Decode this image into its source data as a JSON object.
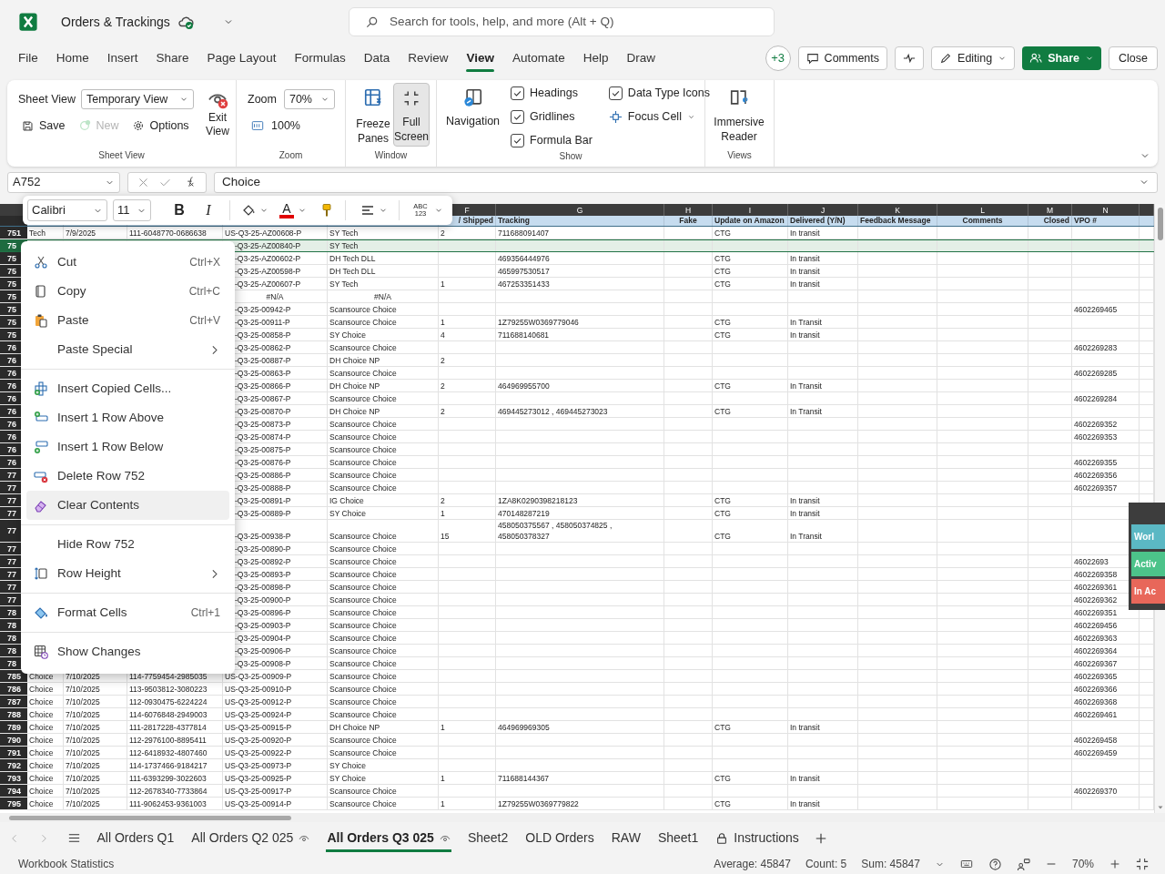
{
  "title_bar": {
    "file_name": "Orders & Trackings",
    "search": {
      "placeholder": "Search for tools, help, and more (Alt + Q)"
    }
  },
  "menu_tabs": [
    {
      "label": "File",
      "selected": false
    },
    {
      "label": "Home",
      "selected": false
    },
    {
      "label": "Insert",
      "selected": false
    },
    {
      "label": "Share",
      "selected": false
    },
    {
      "label": "Page Layout",
      "selected": false
    },
    {
      "label": "Formulas",
      "selected": false
    },
    {
      "label": "Data",
      "selected": false
    },
    {
      "label": "Review",
      "selected": false
    },
    {
      "label": "View",
      "selected": true
    },
    {
      "label": "Automate",
      "selected": false
    },
    {
      "label": "Help",
      "selected": false
    },
    {
      "label": "Draw",
      "selected": false
    }
  ],
  "header_actions": {
    "collaborators": "+3",
    "comments": "Comments",
    "editing": "Editing",
    "share": "Share",
    "close": "Close"
  },
  "ribbon": {
    "sheet_view": {
      "label": "Sheet View",
      "title": "Sheet View",
      "view": "Temporary View",
      "save": "Save",
      "new": {
        "label": "New",
        "disabled": true
      },
      "options": "Options",
      "exit": "Exit View"
    },
    "zoom": {
      "label": "Zoom",
      "title": "Zoom",
      "value": "70%",
      "reset": "100%"
    },
    "window": {
      "label": "Window",
      "freeze": "Freeze Panes",
      "full_screen": {
        "label": "Full Screen",
        "pressed": true
      }
    },
    "show": {
      "label": "Show",
      "navigation": "Navigation",
      "options": [
        {
          "kind": "checkbox",
          "label": "Headings",
          "checked": true
        },
        {
          "kind": "checkbox",
          "label": "Gridlines",
          "checked": true
        },
        {
          "kind": "checkbox",
          "label": "Formula Bar",
          "checked": true
        },
        {
          "kind": "checkbox",
          "label": "Data Type Icons",
          "checked": true
        },
        {
          "kind": "dropdown",
          "label": "Focus Cell"
        }
      ]
    },
    "views": {
      "label": "Views",
      "immersive_reader": "Immersive Reader"
    }
  },
  "formula_bar": {
    "name_box": "A752",
    "formula": "Choice"
  },
  "sheet": {
    "columns": [
      {
        "letter": "F",
        "header": "/ Shipped"
      },
      {
        "letter": "G",
        "header": "Tracking"
      },
      {
        "letter": "H",
        "header": "Fake"
      },
      {
        "letter": "I",
        "header": "Update on Amazon"
      },
      {
        "letter": "J",
        "header": "Delivered (Y/N)"
      },
      {
        "letter": "K",
        "header": "Feedback Message"
      },
      {
        "letter": "L",
        "header": "Comments"
      },
      {
        "letter": "M",
        "header": "Closed"
      },
      {
        "letter": "N",
        "header": "VPO #"
      }
    ],
    "rows": [
      {
        "number": "751",
        "kind": "visible",
        "selected": false,
        "cells": {
          "A": "Tech",
          "B": "7/9/2025",
          "C": "111-6048770-0686638",
          "D": "US-Q3-25-AZ00608-P",
          "E": "SY Tech",
          "F": "2",
          "G": "711688091407",
          "I": "CTG",
          "J": "In transit"
        }
      },
      {
        "number": "75",
        "kind": "covered",
        "selected": true,
        "cells": {
          "D": "-Q3-25-AZ00840-P",
          "E": "SY Tech"
        }
      },
      {
        "number": "75",
        "kind": "covered",
        "selected": false,
        "cells": {
          "D": "-Q3-25-AZ00602-P",
          "E": "DH Tech DLL",
          "G": "469356444976",
          "I": "CTG",
          "J": "In transit"
        }
      },
      {
        "number": "75",
        "kind": "covered",
        "selected": false,
        "cells": {
          "D": "-Q3-25-AZ00598-P",
          "E": "DH Tech DLL",
          "G": "465997530517",
          "I": "CTG",
          "J": "In transit"
        }
      },
      {
        "number": "75",
        "kind": "covered",
        "selected": false,
        "cells": {
          "D": "-Q3-25-AZ00607-P",
          "E": "SY Tech",
          "F": "1",
          "G": "467253351433",
          "I": "CTG",
          "J": "In transit"
        }
      },
      {
        "number": "75",
        "kind": "covered_centered",
        "selected": false,
        "cells": {
          "D": "#N/A",
          "E": "#N/A"
        }
      },
      {
        "number": "75",
        "kind": "covered",
        "selected": false,
        "cells": {
          "D": "-Q3-25-00942-P",
          "E": "Scansource Choice",
          "N": "4602269465"
        }
      },
      {
        "number": "75",
        "kind": "covered",
        "selected": false,
        "cells": {
          "D": "-Q3-25-00911-P",
          "E": "Scansource Choice",
          "F": "1",
          "G": "1Z79255W0369779046",
          "I": "CTG",
          "J": "In Transit"
        }
      },
      {
        "number": "75",
        "kind": "covered",
        "selected": false,
        "cells": {
          "D": "-Q3-25-00858-P",
          "E": "SY Choice",
          "F": "4",
          "G": "711688140681",
          "I": "CTG",
          "J": "In transit"
        }
      },
      {
        "number": "76",
        "kind": "covered",
        "selected": false,
        "cells": {
          "D": "-Q3-25-00862-P",
          "E": "Scansource Choice",
          "N": "4602269283"
        }
      },
      {
        "number": "76",
        "kind": "covered",
        "selected": false,
        "cells": {
          "D": "-Q3-25-00887-P",
          "E": "DH Choice NP",
          "F": "2"
        }
      },
      {
        "number": "76",
        "kind": "covered",
        "selected": false,
        "cells": {
          "D": "-Q3-25-00863-P",
          "E": "Scansource Choice",
          "N": "4602269285"
        }
      },
      {
        "number": "76",
        "kind": "covered",
        "selected": false,
        "cells": {
          "D": "-Q3-25-00866-P",
          "E": "DH Choice NP",
          "F": "2",
          "G": "464969955700",
          "I": "CTG",
          "J": "In Transit"
        }
      },
      {
        "number": "76",
        "kind": "covered",
        "selected": false,
        "cells": {
          "D": "-Q3-25-00867-P",
          "E": "Scansource Choice",
          "N": "4602269284"
        }
      },
      {
        "number": "76",
        "kind": "covered",
        "selected": false,
        "cells": {
          "D": "-Q3-25-00870-P",
          "E": "DH Choice NP",
          "F": "2",
          "G": "469445273012 , 469445273023",
          "I": "CTG",
          "J": "In Transit"
        }
      },
      {
        "number": "76",
        "kind": "covered",
        "selected": false,
        "cells": {
          "D": "-Q3-25-00873-P",
          "E": "Scansource Choice",
          "N": "4602269352"
        }
      },
      {
        "number": "76",
        "kind": "covered",
        "selected": false,
        "cells": {
          "D": "-Q3-25-00874-P",
          "E": "Scansource Choice",
          "N": "4602269353"
        }
      },
      {
        "number": "76",
        "kind": "covered",
        "selected": false,
        "cells": {
          "D": "-Q3-25-00875-P",
          "E": "Scansource Choice"
        }
      },
      {
        "number": "76",
        "kind": "covered",
        "selected": false,
        "cells": {
          "D": "-Q3-25-00876-P",
          "E": "Scansource Choice",
          "N": "4602269355"
        }
      },
      {
        "number": "77",
        "kind": "covered",
        "selected": false,
        "cells": {
          "D": "-Q3-25-00886-P",
          "E": "Scansource Choice",
          "N": "4602269356"
        }
      },
      {
        "number": "77",
        "kind": "covered",
        "selected": false,
        "cells": {
          "D": "-Q3-25-00888-P",
          "E": "Scansource Choice",
          "N": "4602269357"
        }
      },
      {
        "number": "77",
        "kind": "covered",
        "selected": false,
        "cells": {
          "D": "-Q3-25-00891-P",
          "E": "IG Choice",
          "F": "2",
          "G": "1ZA8K0290398218123",
          "I": "CTG",
          "J": "In transit"
        }
      },
      {
        "number": "77",
        "kind": "covered",
        "selected": false,
        "cells": {
          "D": "-Q3-25-00889-P",
          "E": "SY Choice",
          "F": "1",
          "G": "470148287219",
          "I": "CTG",
          "J": "In transit"
        }
      },
      {
        "number": "77",
        "kind": "covered",
        "selected": false,
        "cells": {
          "D": "-Q3-25-00938-P",
          "E": "Scansource Choice",
          "F": "15",
          "G": "458050375567 , 458050374825 , 458050378327",
          "I": "CTG",
          "J": "In Transit"
        }
      },
      {
        "number": "77",
        "kind": "covered",
        "selected": false,
        "cells": {
          "D": "-Q3-25-00890-P",
          "E": "Scansource Choice"
        }
      },
      {
        "number": "77",
        "kind": "covered",
        "selected": false,
        "cells": {
          "D": "-Q3-25-00892-P",
          "E": "Scansource Choice",
          "N": "46022693"
        }
      },
      {
        "number": "77",
        "kind": "covered",
        "selected": false,
        "cells": {
          "D": "-Q3-25-00893-P",
          "E": "Scansource Choice",
          "N": "4602269358"
        }
      },
      {
        "number": "77",
        "kind": "covered",
        "selected": false,
        "cells": {
          "D": "-Q3-25-00898-P",
          "E": "Scansource Choice",
          "N": "4602269361"
        }
      },
      {
        "number": "77",
        "kind": "covered",
        "selected": false,
        "cells": {
          "D": "-Q3-25-00900-P",
          "E": "Scansource Choice",
          "N": "4602269362"
        }
      },
      {
        "number": "78",
        "kind": "covered",
        "selected": false,
        "cells": {
          "D": "-Q3-25-00896-P",
          "E": "Scansource Choice",
          "N": "4602269351"
        }
      },
      {
        "number": "78",
        "kind": "covered",
        "selected": false,
        "cells": {
          "D": "-Q3-25-00903-P",
          "E": "Scansource Choice",
          "N": "4602269456"
        }
      },
      {
        "number": "78",
        "kind": "covered",
        "selected": false,
        "cells": {
          "D": "-Q3-25-00904-P",
          "E": "Scansource Choice",
          "N": "4602269363"
        }
      },
      {
        "number": "78",
        "kind": "covered",
        "selected": false,
        "cells": {
          "D": "-Q3-25-00906-P",
          "E": "Scansource Choice",
          "N": "4602269364"
        }
      },
      {
        "number": "78",
        "kind": "covered",
        "selected": false,
        "cells": {
          "D": "-Q3-25-00908-P",
          "E": "Scansource Choice",
          "N": "4602269367"
        }
      },
      {
        "number": "785",
        "kind": "visible",
        "selected": false,
        "cells": {
          "A": "Choice",
          "B": "7/10/2025",
          "C": "114-7759454-2985035",
          "D": "US-Q3-25-00909-P",
          "E": "Scansource Choice",
          "N": "4602269365"
        }
      },
      {
        "number": "786",
        "kind": "visible",
        "selected": false,
        "cells": {
          "A": "Choice",
          "B": "7/10/2025",
          "C": "113-9503812-3080223",
          "D": "US-Q3-25-00910-P",
          "E": "Scansource Choice",
          "N": "4602269366"
        }
      },
      {
        "number": "787",
        "kind": "visible",
        "selected": false,
        "cells": {
          "A": "Choice",
          "B": "7/10/2025",
          "C": "112-0930475-6224224",
          "D": "US-Q3-25-00912-P",
          "E": "Scansource Choice",
          "N": "4602269368"
        }
      },
      {
        "number": "788",
        "kind": "visible",
        "selected": false,
        "cells": {
          "A": "Choice",
          "B": "7/10/2025",
          "C": "114-6076848-2949003",
          "D": "US-Q3-25-00924-P",
          "E": "Scansource Choice",
          "N": "4602269461"
        }
      },
      {
        "number": "789",
        "kind": "visible",
        "selected": false,
        "cells": {
          "A": "Choice",
          "B": "7/10/2025",
          "C": "111-2817228-4377814",
          "D": "US-Q3-25-00915-P",
          "E": "DH Choice NP",
          "F": "1",
          "G": "464969969305",
          "I": "CTG",
          "J": "In transit"
        }
      },
      {
        "number": "790",
        "kind": "visible",
        "selected": false,
        "cells": {
          "A": "Choice",
          "B": "7/10/2025",
          "C": "112-2976100-8895411",
          "D": "US-Q3-25-00920-P",
          "E": "Scansource Choice",
          "N": "4602269458"
        }
      },
      {
        "number": "791",
        "kind": "visible",
        "selected": false,
        "cells": {
          "A": "Choice",
          "B": "7/10/2025",
          "C": "112-6418932-4807460",
          "D": "US-Q3-25-00922-P",
          "E": "Scansource Choice",
          "N": "4602269459"
        }
      },
      {
        "number": "792",
        "kind": "visible",
        "selected": false,
        "cells": {
          "A": "Choice",
          "B": "7/10/2025",
          "C": "114-1737466-9184217",
          "D": "US-Q3-25-00973-P",
          "E": "SY Choice"
        }
      },
      {
        "number": "793",
        "kind": "visible",
        "selected": false,
        "cells": {
          "A": "Choice",
          "B": "7/10/2025",
          "C": "111-6393299-3022603",
          "D": "US-Q3-25-00925-P",
          "E": "SY Choice",
          "F": "1",
          "G": "711688144367",
          "I": "CTG",
          "J": "In transit"
        }
      },
      {
        "number": "794",
        "kind": "visible",
        "selected": false,
        "cells": {
          "A": "Choice",
          "B": "7/10/2025",
          "C": "112-2678340-7733864",
          "D": "US-Q3-25-00917-P",
          "E": "Scansource Choice",
          "N": "4602269370"
        }
      },
      {
        "number": "795",
        "kind": "visible",
        "selected": false,
        "cells": {
          "A": "Choice",
          "B": "7/10/2025",
          "C": "111-9062453-9361003",
          "D": "US-Q3-25-00914-P",
          "E": "Scansource Choice",
          "F": "1",
          "G": "1Z79255W0369779822",
          "I": "CTG",
          "J": "In transit"
        }
      }
    ]
  },
  "mini_toolbar": {
    "font": "Calibri",
    "size": "11",
    "bold": "B",
    "italic": "I",
    "font_color": "A",
    "number_format": "ABC 123"
  },
  "context_menu": {
    "items": [
      {
        "kind": "item",
        "label": "Cut",
        "shortcut": "Ctrl+X",
        "submenu": false,
        "highlighted": false
      },
      {
        "kind": "item",
        "label": "Copy",
        "shortcut": "Ctrl+C",
        "submenu": false,
        "highlighted": false
      },
      {
        "kind": "item",
        "label": "Paste",
        "shortcut": "Ctrl+V",
        "submenu": false,
        "highlighted": false
      },
      {
        "kind": "item",
        "label": "Paste Special",
        "submenu": true,
        "highlighted": false
      },
      {
        "kind": "separator"
      },
      {
        "kind": "item",
        "label": "Insert Copied Cells...",
        "submenu": false,
        "highlighted": false
      },
      {
        "kind": "item",
        "label": "Insert 1 Row Above",
        "submenu": false,
        "highlighted": false
      },
      {
        "kind": "item",
        "label": "Insert 1 Row Below",
        "submenu": false,
        "highlighted": false
      },
      {
        "kind": "item",
        "label": "Delete Row 752",
        "submenu": false,
        "highlighted": false
      },
      {
        "kind": "item",
        "label": "Clear Contents",
        "submenu": false,
        "highlighted": true
      },
      {
        "kind": "separator"
      },
      {
        "kind": "item",
        "label": "Hide Row 752",
        "submenu": false,
        "highlighted": false
      },
      {
        "kind": "item",
        "label": "Row Height",
        "submenu": true,
        "highlighted": false
      },
      {
        "kind": "separator"
      },
      {
        "kind": "item",
        "label": "Format Cells",
        "shortcut": "Ctrl+1",
        "submenu": false,
        "highlighted": false
      },
      {
        "kind": "separator"
      },
      {
        "kind": "item",
        "label": "Show Changes",
        "submenu": false,
        "highlighted": false
      }
    ]
  },
  "side_panel": {
    "buttons": [
      {
        "label": "Worl",
        "color": "#5bb8c4"
      },
      {
        "label": "Activ",
        "color": "#4cc38a"
      },
      {
        "label": "In Ac",
        "color": "#e8675a"
      }
    ]
  },
  "sheet_tabs": [
    {
      "label": "All Orders Q1",
      "selected": false
    },
    {
      "label": "All Orders Q2 025",
      "selected": false
    },
    {
      "label": "All Orders Q3 025",
      "selected": true
    },
    {
      "label": "Sheet2",
      "selected": false
    },
    {
      "label": "OLD Orders",
      "selected": false
    },
    {
      "label": "RAW",
      "selected": false
    },
    {
      "label": "Sheet1",
      "selected": false
    },
    {
      "label": "Instructions",
      "selected": false
    }
  ],
  "status_bar": {
    "left": "Workbook Statistics",
    "stats": [
      "Average: 45847",
      "Count: 5",
      "Sum: 45847"
    ],
    "zoom": "70%"
  }
}
